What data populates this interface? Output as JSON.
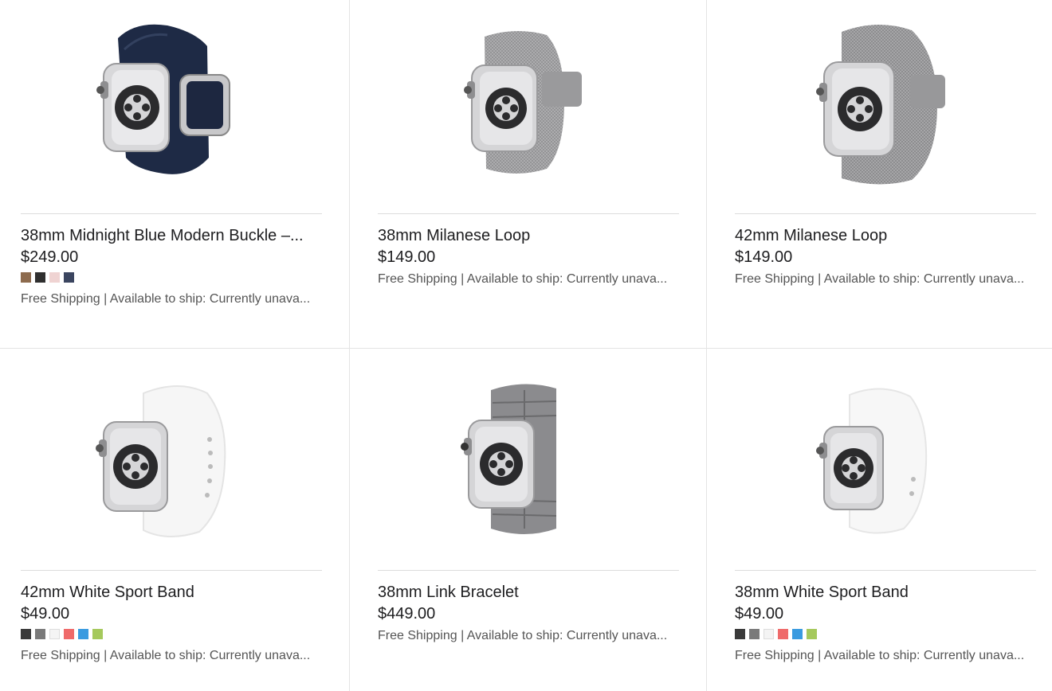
{
  "products": [
    {
      "name": "38mm Midnight Blue Modern Buckle –...",
      "price": "$249.00",
      "swatches": [
        "#8d6b4e",
        "#2f2f2f",
        "#efd3d2",
        "#3b4560"
      ],
      "shipping": "Free Shipping | Available to ship: Currently unava...",
      "image_icon": "midnight-blue-modern-buckle-watch",
      "band_color": "#1e2a45"
    },
    {
      "name": "38mm Milanese Loop",
      "price": "$149.00",
      "swatches": [],
      "shipping": "Free Shipping | Available to ship: Currently unava...",
      "image_icon": "milanese-loop-watch",
      "band_color": "#a9a9ab"
    },
    {
      "name": "42mm Milanese Loop",
      "price": "$149.00",
      "swatches": [],
      "shipping": "Free Shipping | Available to ship: Currently unava...",
      "image_icon": "milanese-loop-watch",
      "band_color": "#a9a9ab"
    },
    {
      "name": "42mm White Sport Band",
      "price": "$49.00",
      "swatches": [
        "#3a3a3a",
        "#7a7a7a",
        "#f4f4f4",
        "#ef6a6a",
        "#3a9be0",
        "#a5c95c"
      ],
      "shipping": "Free Shipping | Available to ship: Currently unava...",
      "image_icon": "white-sport-band-watch",
      "band_color": "#f6f6f6"
    },
    {
      "name": "38mm Link Bracelet",
      "price": "$449.00",
      "swatches": [],
      "shipping": "Free Shipping | Available to ship: Currently unava...",
      "image_icon": "link-bracelet-watch",
      "band_color": "#8b8b8e"
    },
    {
      "name": "38mm White Sport Band",
      "price": "$49.00",
      "swatches": [
        "#3a3a3a",
        "#7a7a7a",
        "#f4f4f4",
        "#ef6a6a",
        "#3a9be0",
        "#a5c95c"
      ],
      "shipping": "Free Shipping | Available to ship: Currently unava...",
      "image_icon": "white-sport-band-watch",
      "band_color": "#f6f6f6"
    }
  ]
}
